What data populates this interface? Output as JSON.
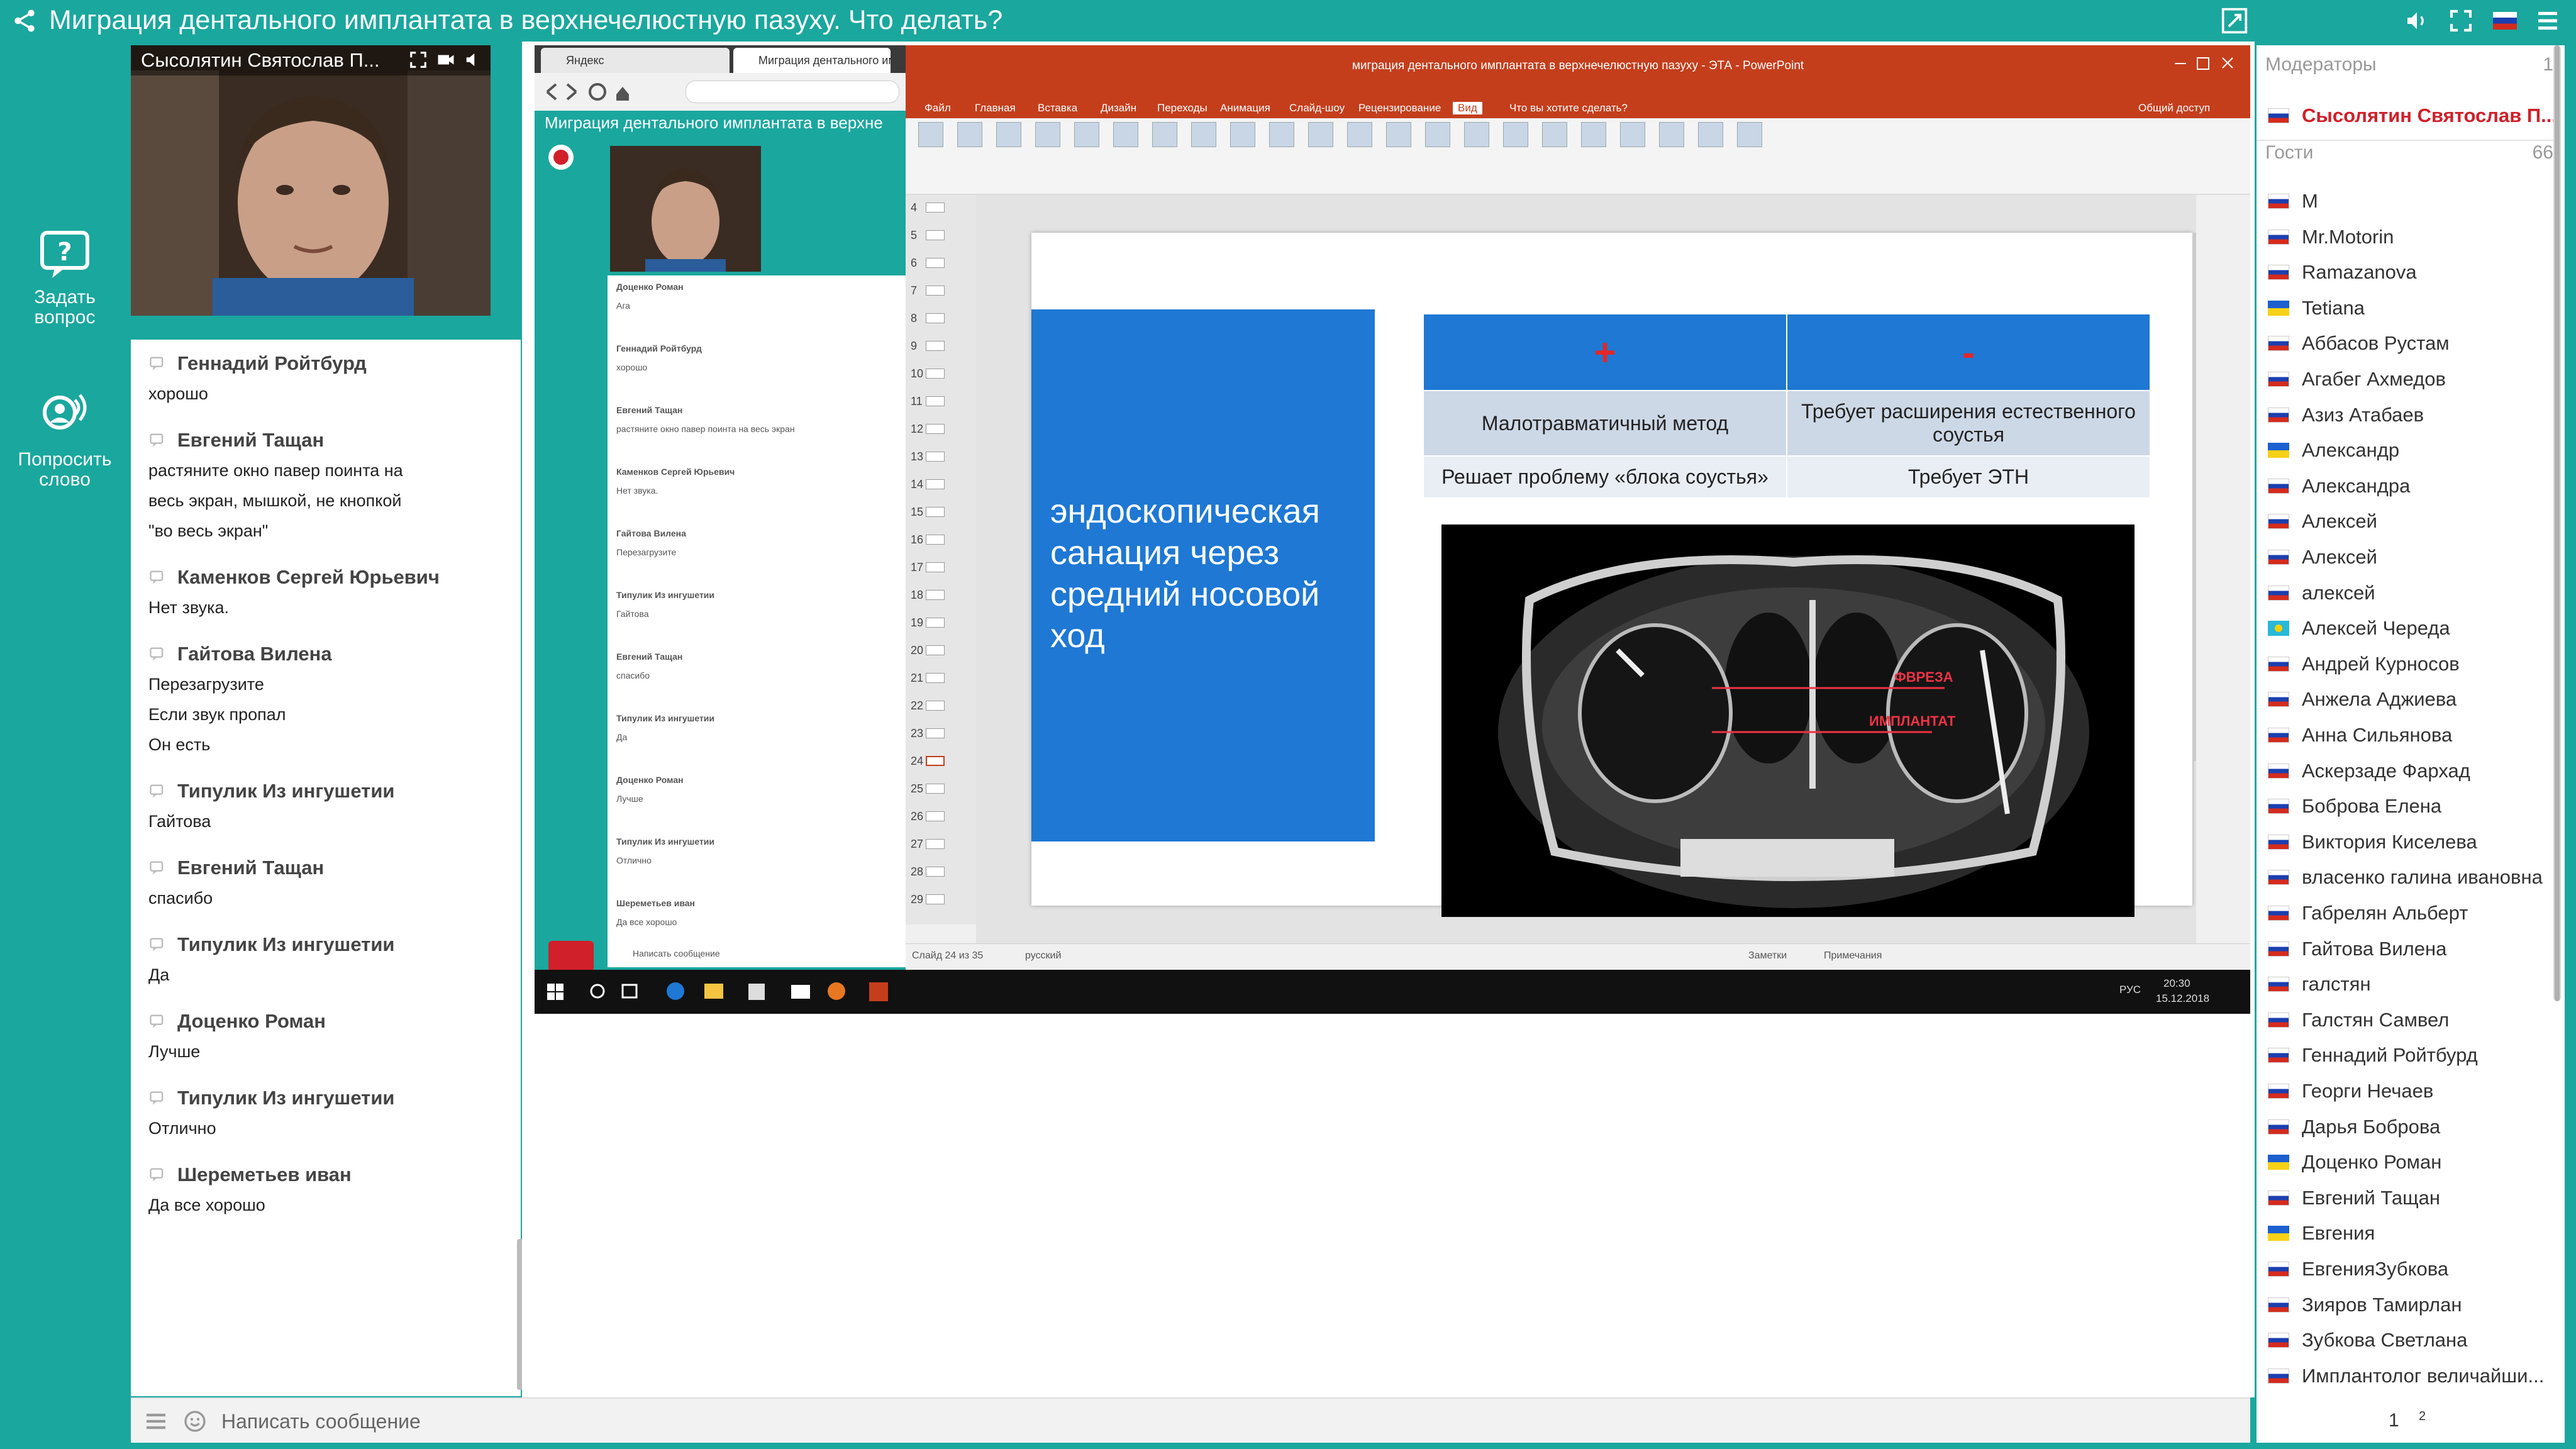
{
  "header": {
    "title": "Миграция дентального имплантата в верхнечелюстную пазуху. Что делать?"
  },
  "left_rail": {
    "ask_question_line1": "Задать",
    "ask_question_line2": "вопрос",
    "request_speak_line1": "Попросить",
    "request_speak_line2": "слово"
  },
  "video": {
    "presenter_label": "Сысолятин Святослав П..."
  },
  "chat": {
    "messages": [
      {
        "author": "Геннадий Ройтбурд",
        "text": "хорошо"
      },
      {
        "author": "Евгений Тащан",
        "text": "растяните окно павер поинта на\nвесь экран, мышкой, не кнопкой\n\"во весь экран\""
      },
      {
        "author": "Каменков Сергей Юрьевич",
        "text": "Нет звука."
      },
      {
        "author": "Гайтова Вилена",
        "text": "Перезагрузите\nЕсли звук пропал\nОн есть"
      },
      {
        "author": "Типулик Из ингушетии",
        "text": "Гайтова"
      },
      {
        "author": "Евгений Тащан",
        "text": "спасибо"
      },
      {
        "author": "Типулик Из ингушетии",
        "text": "Да"
      },
      {
        "author": "Доценко Роман",
        "text": "Лучше"
      },
      {
        "author": "Типулик Из ингушетии",
        "text": "Отлично"
      },
      {
        "author": "Шереметьев иван",
        "text": "Да все хорошо"
      }
    ],
    "input_placeholder": "Написать сообщение"
  },
  "shared_screen": {
    "browser_tab1": "Яндекс",
    "browser_tab2": "Миграция дентального имп",
    "inner_title": "Миграция дентального имплантата в верхне",
    "inner_chat": [
      {
        "author": "Доценко Роман",
        "text": "Ага"
      },
      {
        "author": "Геннадий Ройтбурд",
        "text": "хорошо"
      },
      {
        "author": "Евгений Тащан",
        "text": "растяните окно павер поинта на весь экран"
      },
      {
        "author": "Каменков Сергей Юрьевич",
        "text": "Нет звука."
      },
      {
        "author": "Гайтова Вилена",
        "text": "Перезагрузите"
      },
      {
        "author": "Типулик Из ингушетии",
        "text": "Гайтова"
      },
      {
        "author": "Евгений Тащан",
        "text": "спасибо"
      },
      {
        "author": "Типулик Из ингушетии",
        "text": "Да"
      },
      {
        "author": "Доценко Роман",
        "text": "Лучше"
      },
      {
        "author": "Типулик Из ингушетии",
        "text": "Отлично"
      },
      {
        "author": "Шереметьев иван",
        "text": "Да все хорошо"
      }
    ],
    "inner_input_placeholder": "Написать сообщение",
    "ppt_window_title": "миграция дентального имплантата в верхнечелюстную пазуху - ЭТА - PowerPoint",
    "ppt_tabs": [
      "Файл",
      "Главная",
      "Вставка",
      "Дизайн",
      "Переходы",
      "Анимация",
      "Слайд-шоу",
      "Рецензирование",
      "Вид",
      "Что вы хотите сделать?"
    ],
    "ppt_share": "Общий доступ",
    "slide_numbers": [
      "4",
      "5",
      "6",
      "7",
      "8",
      "9",
      "10",
      "11",
      "12",
      "13",
      "14",
      "15",
      "16",
      "17",
      "18",
      "19",
      "20",
      "21",
      "22",
      "23",
      "24",
      "25",
      "26",
      "27",
      "28",
      "29"
    ],
    "slide": {
      "blue_text": "эндоскопическая санация через средний носовой ход",
      "table_header_plus": "+",
      "table_header_minus": "-",
      "row1_left": "Малотравматичный метод",
      "row1_right": "Требует расширения естественного соустья",
      "row2_left": "Решает проблему «блока соустья»",
      "row2_right": "Требует ЭТН",
      "ct_label1": "ФВРЕЗА",
      "ct_label2": "ИМПЛАНТАТ"
    },
    "status_left": "Слайд 24 из 35",
    "status_lang": "русский",
    "status_notes": "Заметки",
    "status_comments": "Примечания",
    "taskbar_time": "20:30",
    "taskbar_date": "15.12.2018",
    "taskbar_lang": "РУС"
  },
  "participants": {
    "moderators_label": "Модераторы",
    "moderators_count": "1",
    "moderator_name": "Сысолятин Святослав П...",
    "guests_label": "Гости",
    "guests_count": "66",
    "guests": [
      {
        "name": "М",
        "flag": "ru"
      },
      {
        "name": "Mr.Motorin",
        "flag": "ru"
      },
      {
        "name": "Ramazanova",
        "flag": "ru"
      },
      {
        "name": "Tetiana",
        "flag": "ua"
      },
      {
        "name": "Аббасов Рустам",
        "flag": "ru"
      },
      {
        "name": "Агабег Ахмедов",
        "flag": "ru"
      },
      {
        "name": "Азиз Атабаев",
        "flag": "ru"
      },
      {
        "name": "Александр",
        "flag": "ua"
      },
      {
        "name": "Александра",
        "flag": "ru"
      },
      {
        "name": "Алексей",
        "flag": "ru"
      },
      {
        "name": "Алексей",
        "flag": "ru"
      },
      {
        "name": "алексей",
        "flag": "ru"
      },
      {
        "name": "Алексей Череда",
        "flag": "kz"
      },
      {
        "name": "Андрей Курносов",
        "flag": "ru"
      },
      {
        "name": "Анжела Аджиева",
        "flag": "ru"
      },
      {
        "name": "Анна Сильянова",
        "flag": "ru"
      },
      {
        "name": "Аскерзаде Фархад",
        "flag": "ru"
      },
      {
        "name": "Боброва Елена",
        "flag": "ru"
      },
      {
        "name": "Виктория Киселева",
        "flag": "ru"
      },
      {
        "name": "власенко галина ивановна",
        "flag": "ru"
      },
      {
        "name": "Габрелян Альберт",
        "flag": "ru"
      },
      {
        "name": "Гайтова Вилена",
        "flag": "ru"
      },
      {
        "name": "галстян",
        "flag": "ru"
      },
      {
        "name": "Галстян Самвел",
        "flag": "ru"
      },
      {
        "name": "Геннадий Ройтбурд",
        "flag": "ru"
      },
      {
        "name": "Георги Нечаев",
        "flag": "ru"
      },
      {
        "name": "Дарья Боброва",
        "flag": "ru"
      },
      {
        "name": "Доценко Роман",
        "flag": "ua"
      },
      {
        "name": "Евгений Тащан",
        "flag": "ru"
      },
      {
        "name": "Евгения",
        "flag": "ua"
      },
      {
        "name": "ЕвгенияЗубкова",
        "flag": "ru"
      },
      {
        "name": "Зияров Тамирлан",
        "flag": "ru"
      },
      {
        "name": "Зубкова Светлана",
        "flag": "ru"
      },
      {
        "name": "Имплантолог величайши...",
        "flag": "ru"
      }
    ],
    "page_current": "1",
    "page_next": "2"
  },
  "colors": {
    "brand": "#1aa79e",
    "slide_blue": "#1e78d4",
    "ppt_red": "#c43e1c",
    "moderator_red": "#d0202a"
  }
}
